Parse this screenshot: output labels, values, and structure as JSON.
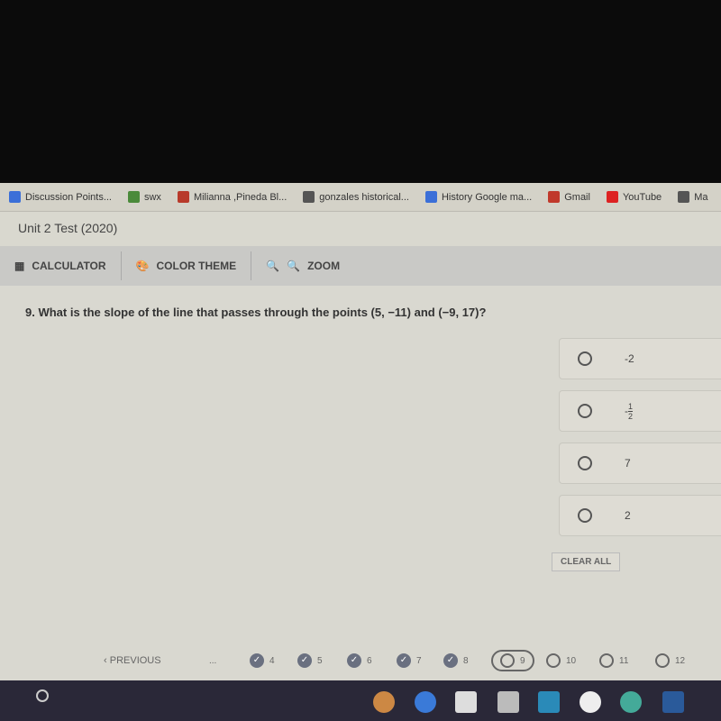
{
  "bookmarks": [
    {
      "label": "Discussion Points...",
      "icon": "docs-icon",
      "color": "#3b6fd8"
    },
    {
      "label": "swx",
      "icon": "app-icon",
      "color": "#4a8a3a"
    },
    {
      "label": "Milianna ,Pineda Bl...",
      "icon": "map-pin-icon",
      "color": "#b83a2a"
    },
    {
      "label": "gonzales historical...",
      "icon": "google-icon",
      "color": "#555"
    },
    {
      "label": "History Google ma...",
      "icon": "docs-icon",
      "color": "#3b6fd8"
    },
    {
      "label": "Gmail",
      "icon": "gmail-icon",
      "color": "#c0392b"
    },
    {
      "label": "YouTube",
      "icon": "youtube-icon",
      "color": "#d22"
    },
    {
      "label": "Ma",
      "icon": "app-icon",
      "color": "#555"
    }
  ],
  "header": {
    "title": "Unit 2 Test (2020)"
  },
  "toolbar": {
    "calculator": "CALCULATOR",
    "color_theme": "COLOR THEME",
    "zoom": "ZOOM"
  },
  "question": {
    "text": "9. What is the slope of the line that passes through the points (5, −11) and (−9, 17)?"
  },
  "choices": [
    {
      "label": "-2"
    },
    {
      "sign": "-",
      "numerator": "1",
      "denominator": "2"
    },
    {
      "label": "7"
    },
    {
      "label": "2"
    }
  ],
  "clear_all": "CLEAR ALL",
  "nav": {
    "previous": "PREVIOUS",
    "ellipsis": "...",
    "items": [
      {
        "num": "4",
        "status": "answered"
      },
      {
        "num": "5",
        "status": "answered"
      },
      {
        "num": "6",
        "status": "answered"
      },
      {
        "num": "7",
        "status": "answered"
      },
      {
        "num": "8",
        "status": "answered"
      },
      {
        "num": "9",
        "status": "current"
      },
      {
        "num": "10",
        "status": "unanswered"
      },
      {
        "num": "11",
        "status": "unanswered"
      },
      {
        "num": "12",
        "status": "unanswered"
      }
    ]
  }
}
